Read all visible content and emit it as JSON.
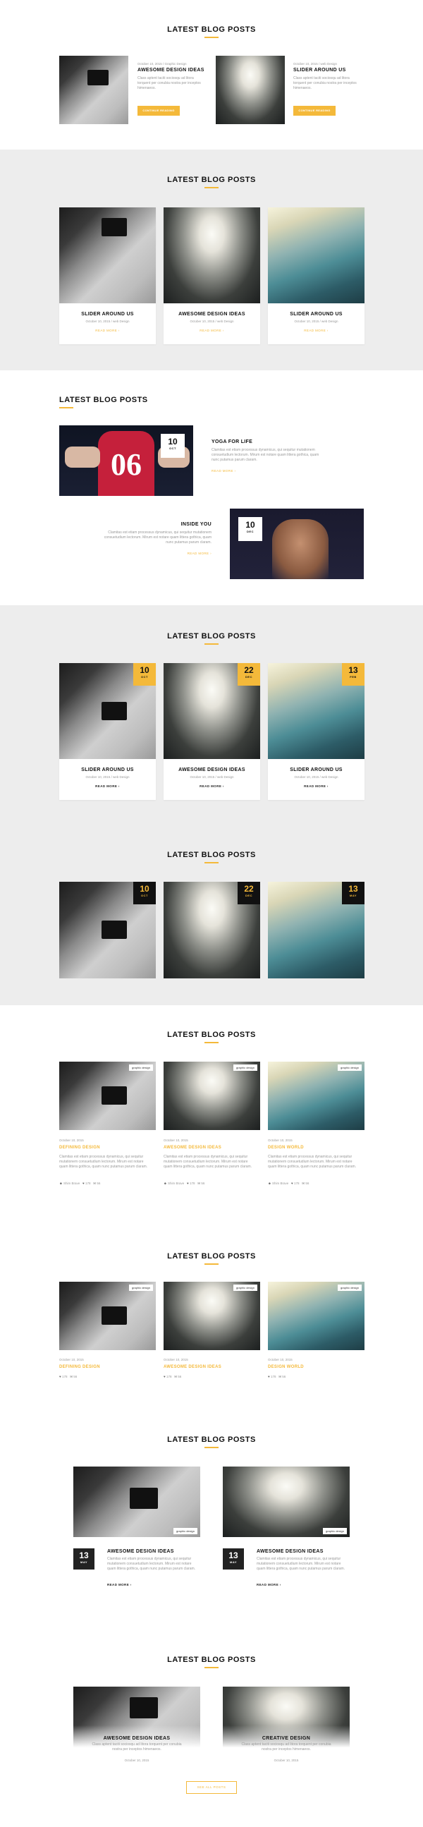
{
  "section_title": "LATEST BLOG POSTS",
  "posts": {
    "awesome": "AWESOME DESIGN IDEAS",
    "slider": "SLIDER AROUND US",
    "yoga": "YOGA FOR LIFE",
    "inside": "INSIDE YOU",
    "defining": "DEFINING DESIGN",
    "design_world": "DESIGN WORLD",
    "creative": "CREATIVE DESIGN"
  },
  "meta": {
    "date_cat1": "October 10, 2015  /  Graphic Design",
    "date_cat2": "October 10, 2015  /  web Design",
    "date": "October 10, 2015"
  },
  "excerpt_short": "Class aptent taciti sociosqu ad litora torquent per conubia nostra per inceptos himenaeos.",
  "excerpt": "Clamitas est etiam processus dynamicus, qui sequitur mutationem consuetudium lectorum. Mirum est notare quam littera gothica, quam nunc putamus parum claram.",
  "read_more": "READ MORE",
  "continue_reading": "CONTINUE READING",
  "dates": {
    "d10": "10",
    "d22": "22",
    "d13": "13",
    "oct": "OCT",
    "dec": "DEC",
    "feb": "FEB",
    "may": "MAY"
  },
  "badge": "graphic design",
  "author": "Shim Brave",
  "likes": "178",
  "comments": "56",
  "view_all": "SEE ALL POSTS",
  "jersey_number": "06",
  "colors": {
    "accent": "#f4b93a",
    "gray_bg": "#ededed",
    "dark": "#222222"
  },
  "icons": [
    "user-icon",
    "heart-icon",
    "comment-icon",
    "arrow-right-icon"
  ]
}
